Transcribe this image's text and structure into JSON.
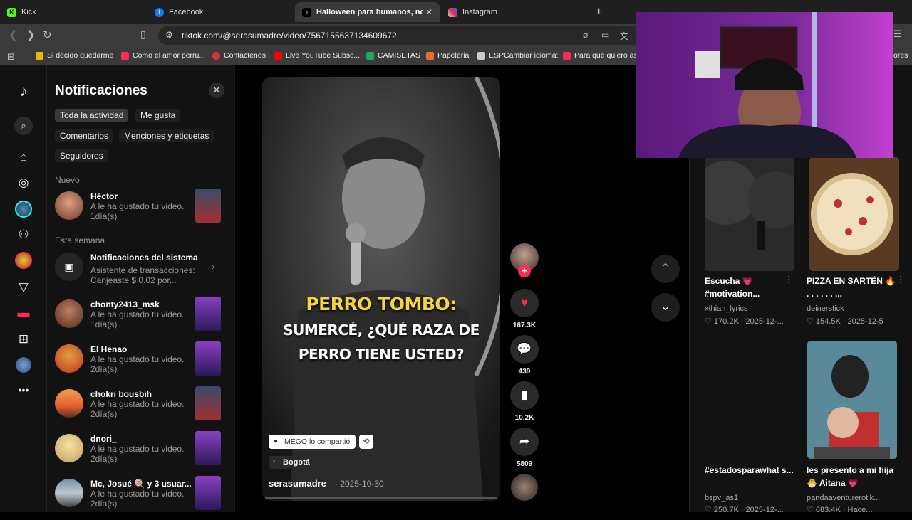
{
  "browser": {
    "tabs": [
      {
        "label": "Kick",
        "color": "#53fc18"
      },
      {
        "label": "Facebook",
        "color": "#1877f2"
      },
      {
        "label": "Halloween para humanos, no pa",
        "color": "#111111"
      },
      {
        "label": "Instagram",
        "color": "#d62976"
      }
    ],
    "new_tab": "+",
    "url": "tiktok.com/@serasumadre/video/7567155637134609672",
    "bookmarks": [
      "Si decido quedarme",
      "Como el amor perru...",
      "Contactenos",
      "Live YouTube Subsc...",
      "CAMISETAS",
      "Papeleria",
      "ESPCambiar idioma:",
      "Para qué quiero asp",
      "ores"
    ]
  },
  "notifications": {
    "title": "Notificaciones",
    "filters": [
      "Toda la actividad",
      "Me gusta",
      "Comentarios",
      "Menciones y etiquetas",
      "Seguidores"
    ],
    "section_new": "Nuevo",
    "section_week": "Esta semana",
    "items": [
      {
        "name": "Héctor",
        "desc": "A le ha gustado tu video.",
        "time": "1día(s)"
      },
      {
        "name": "Notificaciones del sistema",
        "desc": "Asistente de transacciones:",
        "desc2": "Canjeaste $ 0.02 por..."
      },
      {
        "name": "chonty2413_msk",
        "desc": "A le ha gustado tu video.",
        "time": "1día(s)"
      },
      {
        "name": "El Henao",
        "desc": "A le ha gustado tu video.",
        "time": "2día(s)"
      },
      {
        "name": "chokri bousbih",
        "desc": "A le ha gustado tu video.",
        "time": "2día(s)"
      },
      {
        "name": "dnori_",
        "desc": "A le ha gustado tu video.",
        "time": "2día(s)"
      },
      {
        "name": "Mc, Josué 🍭 y 3 usuar...",
        "desc": "A le ha gustado tu video.",
        "time": "2día(s)"
      }
    ]
  },
  "video": {
    "caption_line1": "PERRO TOMBO:",
    "caption_line2": "SUMERCÉ, ¿QUÉ RAZA DE",
    "caption_line3": "PERRO TIENE USTED?",
    "shared_by": "MEGO lo compartió",
    "location": "Bogotá",
    "author": "serasumadre",
    "date": "· 2025-10-30",
    "likes": "167.3K",
    "comments": "439",
    "saves": "10.2K",
    "shares": "5809"
  },
  "grid": [
    {
      "title": "Escucha 💗 #motivation...",
      "author": "xthian_lyrics",
      "meta": "♡ 170.2K · 2025-12-..."
    },
    {
      "title": "PIZZA EN SARTÉN 🔥 . . . . . . ...",
      "author": "deinerstick",
      "meta": "♡ 154.5K · 2025-12-5"
    },
    {
      "title": "#estadosparawhat s...",
      "author": "bspv_as1",
      "meta": "♡ 250.7K · 2025-12-..."
    },
    {
      "title": "les presento a mi hija 🐣 Aitana 💗",
      "author": "pandaaventurerotik...",
      "meta": "♡ 683.4K · Hace..."
    }
  ],
  "colors": {
    "like": "#fe2c55",
    "caption_yellow": "#f5d442",
    "accent": "#25f4ee"
  }
}
